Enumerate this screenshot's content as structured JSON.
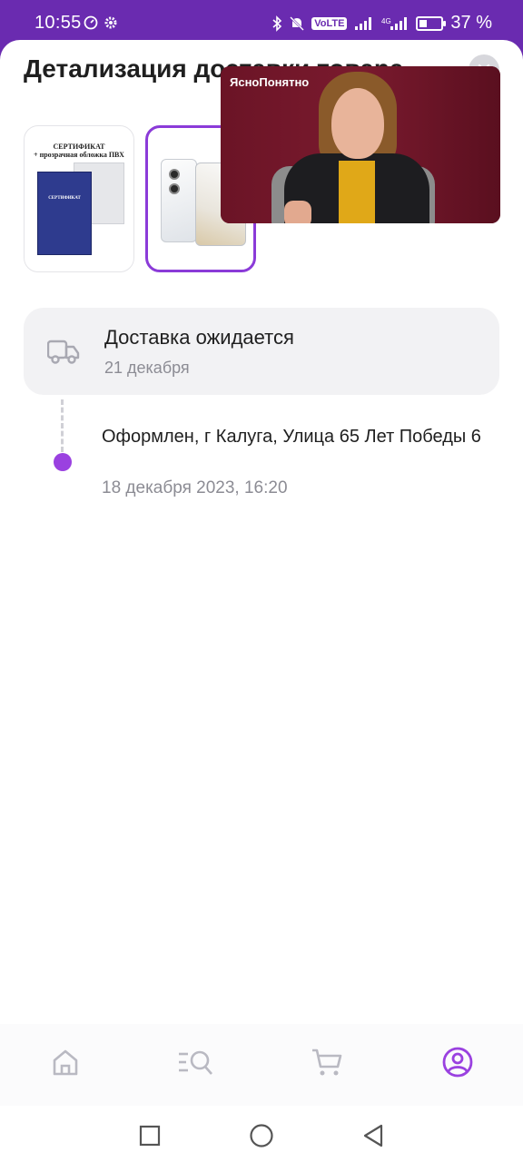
{
  "status_bar": {
    "time": "10:55",
    "volte": "VoLTE",
    "battery_percent": "37 %",
    "battery_level": 0.37
  },
  "sheet": {
    "title": "Детализация доставки товара",
    "close_icon": "close-icon"
  },
  "thumbnails": [
    {
      "name": "certificate",
      "lines": [
        "СЕРТИФИКАТ",
        "+ прозрачная обложка ПВХ"
      ],
      "book_text": "СЕРТИФИКАТ"
    },
    {
      "name": "phone",
      "selected": true
    }
  ],
  "video_overlay": {
    "channel": "ЯсноПонятно"
  },
  "delivery": {
    "status_title": "Доставка ожидается",
    "status_date": "21 декабря",
    "icon": "truck-icon"
  },
  "timeline": [
    {
      "text": "Оформлен, г Калуга, Улица 65 Лет Победы 6",
      "date": "18 декабря 2023, 16:20"
    }
  ],
  "bottom_nav": {
    "items": [
      "home-icon",
      "catalog-search-icon",
      "cart-icon",
      "profile-icon"
    ],
    "active": "profile-icon",
    "active_color": "#9a41e0",
    "inactive_color": "#b9b9c2"
  },
  "colors": {
    "brand": "#6a2bb0",
    "accent": "#9a41e0"
  }
}
